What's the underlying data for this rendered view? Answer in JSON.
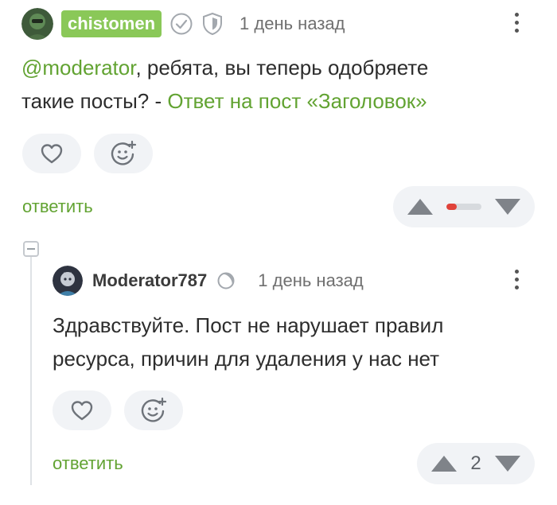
{
  "comments": [
    {
      "username": "chistomen",
      "timestamp": "1 день назад",
      "mention": "@moderator",
      "text_main": ", ребята, вы теперь одобряете",
      "text_line2": "такие посты? - ",
      "reply_link_text": "Ответ на пост «Заголовок»",
      "reply_label": "ответить",
      "rating_negative_fraction": 0.3
    },
    {
      "username": "Moderator787",
      "timestamp": "1 день назад",
      "text_line1": "Здравствуйте. Пост не нарушает правил",
      "text_line2": "ресурса, причин для удаления у нас нет",
      "reply_label": "ответить",
      "score": "2"
    }
  ],
  "colors": {
    "accent": "#62a332",
    "username_badge": "#8ac858",
    "rating_negative": "#e0423a"
  },
  "icons": [
    "verified-check-icon",
    "shield-icon",
    "kebab-menu-icon",
    "heart-icon",
    "add-reaction-icon",
    "arrow-up-icon",
    "arrow-down-icon",
    "collapse-icon",
    "moon-icon"
  ]
}
